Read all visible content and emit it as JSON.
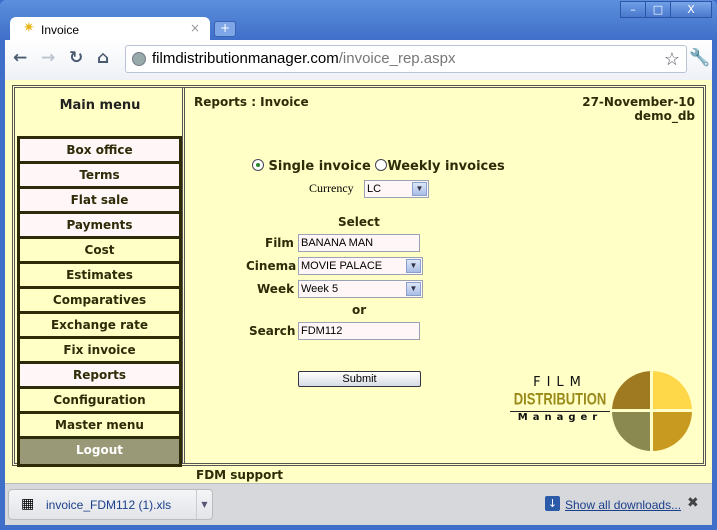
{
  "browser": {
    "tab_title": "Invoice",
    "tab_close": "×",
    "new_tab": "+",
    "url_host": "filmdistributionmanager.com",
    "url_path": "/invoice_rep.aspx",
    "minimize": "–",
    "maximize": "□",
    "close": "X"
  },
  "sidebar": {
    "title": "Main menu",
    "items": [
      {
        "label": "Box office",
        "style": "pink"
      },
      {
        "label": "Terms",
        "style": "pink"
      },
      {
        "label": "Flat sale",
        "style": "pink"
      },
      {
        "label": "Payments",
        "style": "pink"
      },
      {
        "label": "Cost",
        "style": "yellow"
      },
      {
        "label": "Estimates",
        "style": "yellow"
      },
      {
        "label": "Comparatives",
        "style": "yellow"
      },
      {
        "label": "Exchange rate",
        "style": "yellow"
      },
      {
        "label": "Fix invoice",
        "style": "yellow"
      },
      {
        "label": "Reports",
        "style": "pink"
      },
      {
        "label": "Configuration",
        "style": "yellow"
      },
      {
        "label": "Master menu",
        "style": "yellow"
      },
      {
        "label": "Logout",
        "style": "gray"
      }
    ]
  },
  "header": {
    "breadcrumb": "Reports : Invoice",
    "date": "27-November-10",
    "db": "demo_db"
  },
  "form": {
    "single_label": "Single invoice",
    "weekly_label": "Weekly invoices",
    "selected": "single",
    "currency_label": "Currency",
    "currency": "LC",
    "select_label": "Select",
    "film_label": "Film",
    "film": "BANANA MAN",
    "cinema_label": "Cinema",
    "cinema": "MOVIE PALACE",
    "week_label": "Week",
    "week": "Week 5",
    "or_label": "or",
    "search_label": "Search",
    "search": "FDM112",
    "submit": "Submit"
  },
  "logo": {
    "line1": "FILM",
    "line2": "DISTRIBUTION",
    "line3": "Manager"
  },
  "footer": {
    "support": "FDM support"
  },
  "downloads": {
    "file": "invoice_FDM112 (1).xls",
    "show_all": "Show all downloads...",
    "close": "✖"
  }
}
